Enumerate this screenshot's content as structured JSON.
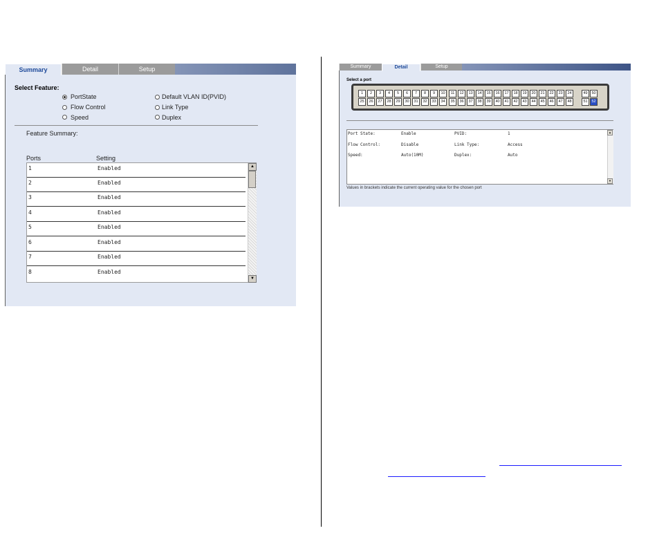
{
  "left": {
    "tabs": [
      {
        "label": "Summary",
        "active": true
      },
      {
        "label": "Detail",
        "active": false
      },
      {
        "label": "Setup",
        "active": false
      }
    ],
    "select_feature_label": "Select Feature:",
    "features": [
      {
        "label": "PortState",
        "checked": true
      },
      {
        "label": "Flow Control",
        "checked": false
      },
      {
        "label": "Speed",
        "checked": false
      },
      {
        "label": "Default VLAN ID(PVID)",
        "checked": false
      },
      {
        "label": "Link Type",
        "checked": false
      },
      {
        "label": "Duplex",
        "checked": false
      }
    ],
    "feature_summary_label": "Feature Summary:",
    "col_ports": "Ports",
    "col_setting": "Setting",
    "rows": [
      {
        "port": "1",
        "setting": "Enabled"
      },
      {
        "port": "2",
        "setting": "Enabled"
      },
      {
        "port": "3",
        "setting": "Enabled"
      },
      {
        "port": "4",
        "setting": "Enabled"
      },
      {
        "port": "5",
        "setting": "Enabled"
      },
      {
        "port": "6",
        "setting": "Enabled"
      },
      {
        "port": "7",
        "setting": "Enabled"
      },
      {
        "port": "8",
        "setting": "Enabled"
      }
    ]
  },
  "right": {
    "tabs": [
      {
        "label": "Summary",
        "active": false
      },
      {
        "label": "Detail",
        "active": true
      },
      {
        "label": "Setup",
        "active": false
      }
    ],
    "select_port_label": "Select a port",
    "ports_row1": [
      "1",
      "2",
      "3",
      "4",
      "5",
      "6",
      "7",
      "8",
      "9",
      "10",
      "11",
      "12",
      "13",
      "14",
      "15",
      "16",
      "17",
      "18",
      "19",
      "20",
      "21",
      "22",
      "23",
      "24"
    ],
    "ports_row2": [
      "25",
      "26",
      "27",
      "28",
      "29",
      "30",
      "31",
      "32",
      "33",
      "34",
      "35",
      "36",
      "37",
      "38",
      "39",
      "40",
      "41",
      "42",
      "43",
      "44",
      "45",
      "46",
      "47",
      "48"
    ],
    "uplinks_row1": [
      "49",
      "50"
    ],
    "uplinks_row2": [
      "51",
      "52"
    ],
    "selected_port": "52",
    "details": {
      "port_state_label": "Port State:",
      "port_state_value": "Enable",
      "pvid_label": "PVID:",
      "pvid_value": "1",
      "flow_label": "Flow Control:",
      "flow_value": "Disable",
      "link_label": "Link Type:",
      "link_value": "Access",
      "speed_label": "Speed:",
      "speed_value": "Auto(10M)",
      "duplex_label": "Duplex:",
      "duplex_value": "Auto"
    },
    "footnote": "Values in brackets indicate the current operating value for the chosen port"
  },
  "colors": {
    "panel_bg": "#e2e8f4",
    "active_tab_text": "#1e4a9a",
    "selected_port": "#2a4fc4",
    "link": "#1a1aff"
  }
}
